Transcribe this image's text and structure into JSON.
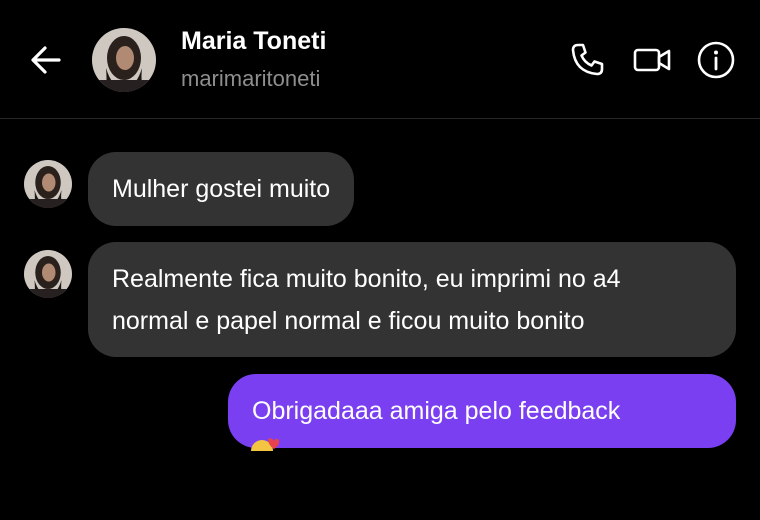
{
  "header": {
    "name": "Maria Toneti",
    "username": "marimaritoneti"
  },
  "icons": {
    "back": "arrow-left-icon",
    "phone": "phone-icon",
    "video": "video-camera-icon",
    "info": "info-icon"
  },
  "messages": [
    {
      "from": "contact",
      "lines": [
        "Mulher gostei muito"
      ]
    },
    {
      "from": "contact",
      "lines": [
        "Realmente fica muito bonito, eu imprimi no a4",
        "normal e papel normal e ficou muito bonito"
      ]
    },
    {
      "from": "me",
      "lines": [
        "Obrigadaaa amiga pelo feedback"
      ]
    }
  ],
  "colors": {
    "background": "#000000",
    "incoming_bubble": "#333333",
    "outgoing_bubble": "#7b3ff2",
    "handle_text": "#8e8e8e"
  }
}
